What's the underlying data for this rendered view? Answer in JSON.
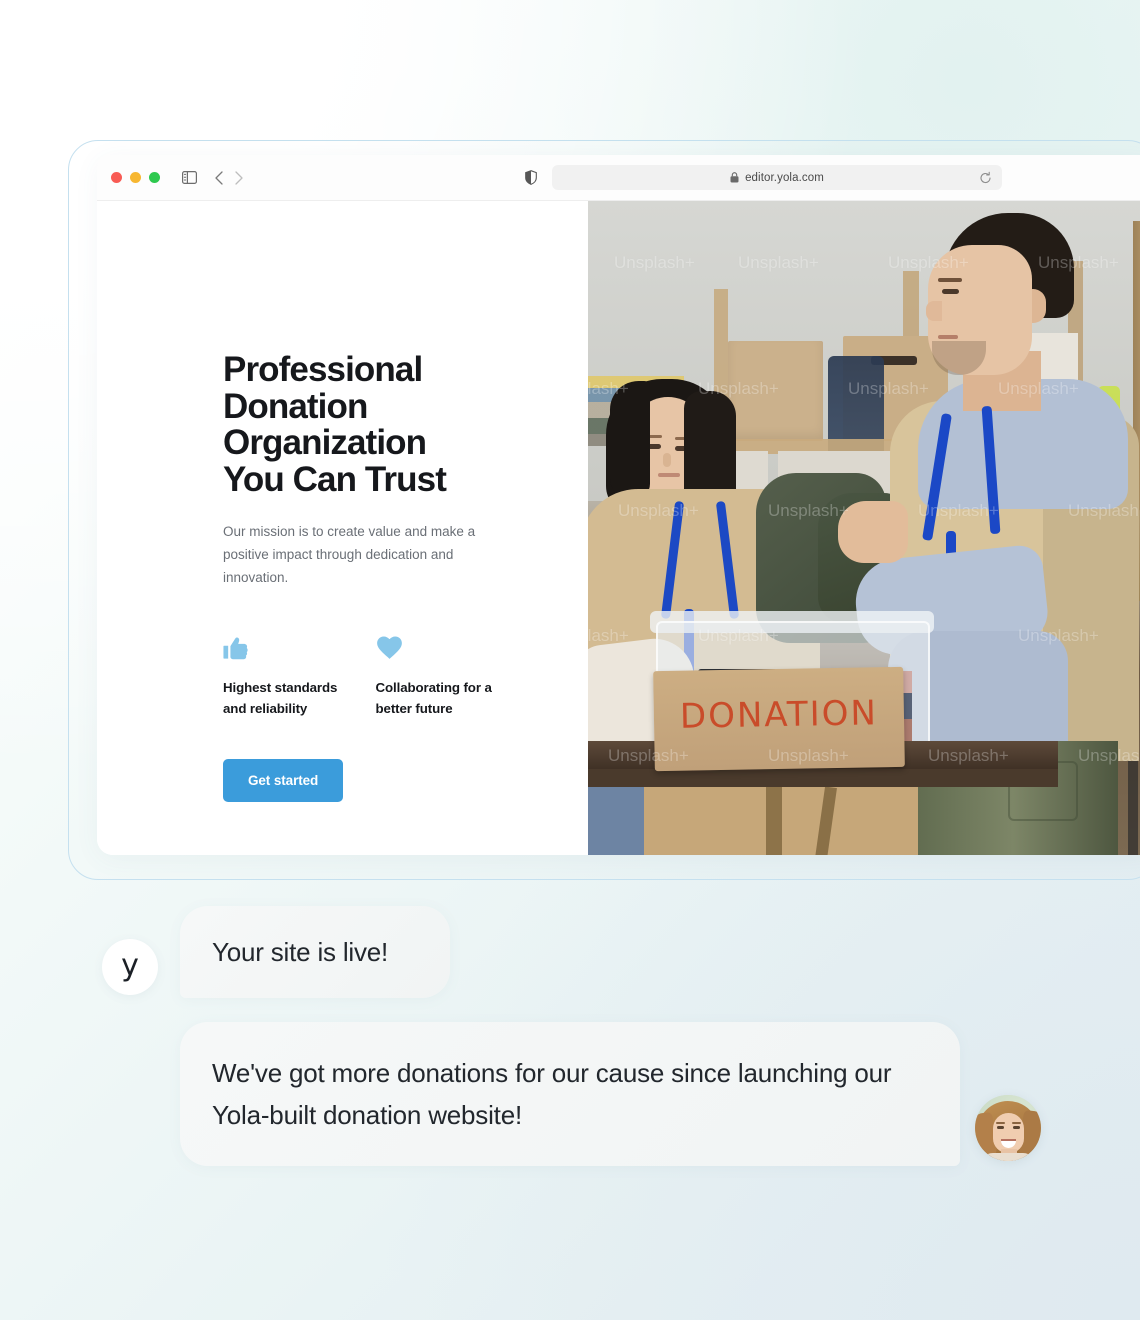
{
  "browser": {
    "traffic_lights": [
      "close",
      "minimize",
      "maximize"
    ],
    "sidebar_toggle": "sidebar-toggle-icon",
    "back": "chevron-left-icon",
    "forward": "chevron-right-icon",
    "shield": "shield-icon",
    "lock": "lock-icon",
    "url": "editor.yola.com",
    "reload": "reload-icon"
  },
  "site": {
    "hero": {
      "title": "Professional Donation Organization You Can Trust",
      "subtitle": "Our mission is to create value and make a positive impact through dedication and innovation.",
      "cta_label": "Get started"
    },
    "features": [
      {
        "icon": "thumbs-up-icon",
        "label": "Highest standards and reliability"
      },
      {
        "icon": "heart-icon",
        "label": "Collaborating for a better future"
      }
    ],
    "photo": {
      "sign_text": "DONATION",
      "watermark_text": "Unsplash+",
      "alt": "Two volunteers wearing blue lanyards sorting donated clothing into a clear plastic bin labelled DONATION on a wooden table in a warehouse"
    }
  },
  "chat": {
    "brand_glyph": "y",
    "messages": [
      {
        "text": "Your site is live!",
        "from": "yola"
      },
      {
        "text": "We've got more donations for our cause since launching our Yola-built donation website!",
        "from": "customer"
      }
    ],
    "customer_avatar_alt": "Smiling woman with long light-brown hair"
  },
  "colors": {
    "accent_blue": "#3b9cdb",
    "icon_blue": "#86c6e9",
    "heading": "#16181c",
    "body_text": "#6a6f76",
    "bubble_bg": "#f4f6f6",
    "frame_border": "#c5e0ef"
  }
}
